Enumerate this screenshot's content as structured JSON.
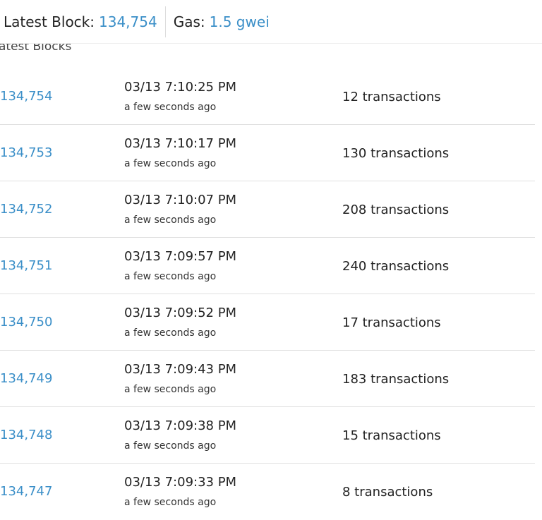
{
  "header": {
    "latest_block_label": "Latest Block:",
    "latest_block_value": "134,754",
    "gas_label": "Gas:",
    "gas_value": "1.5 gwei"
  },
  "section": {
    "title": "atest Blocks"
  },
  "blocks": [
    {
      "number": "134,754",
      "time": "03/13 7:10:25 PM",
      "ago": "a few seconds ago",
      "txs": "12 transactions"
    },
    {
      "number": "134,753",
      "time": "03/13 7:10:17 PM",
      "ago": "a few seconds ago",
      "txs": "130 transactions"
    },
    {
      "number": "134,752",
      "time": "03/13 7:10:07 PM",
      "ago": "a few seconds ago",
      "txs": "208 transactions"
    },
    {
      "number": "134,751",
      "time": "03/13 7:09:57 PM",
      "ago": "a few seconds ago",
      "txs": "240 transactions"
    },
    {
      "number": "134,750",
      "time": "03/13 7:09:52 PM",
      "ago": "a few seconds ago",
      "txs": "17 transactions"
    },
    {
      "number": "134,749",
      "time": "03/13 7:09:43 PM",
      "ago": "a few seconds ago",
      "txs": "183 transactions"
    },
    {
      "number": "134,748",
      "time": "03/13 7:09:38 PM",
      "ago": "a few seconds ago",
      "txs": "15 transactions"
    },
    {
      "number": "134,747",
      "time": "03/13 7:09:33 PM",
      "ago": "a few seconds ago",
      "txs": "8 transactions"
    }
  ]
}
